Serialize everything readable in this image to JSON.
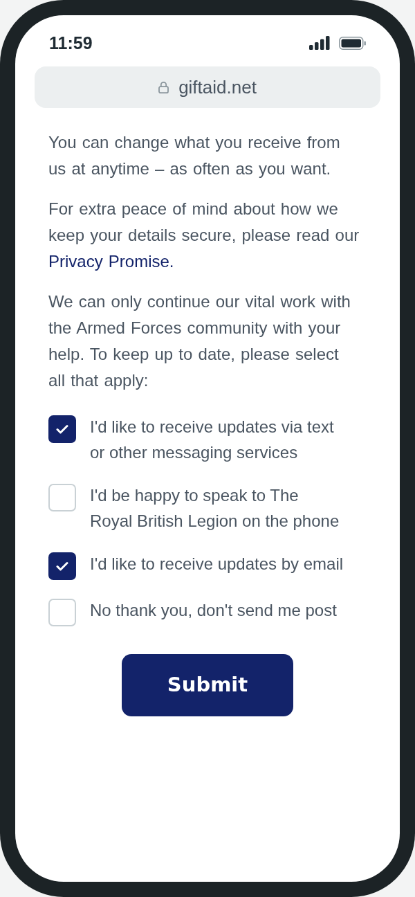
{
  "status_bar": {
    "time": "11:59"
  },
  "address_bar": {
    "url": "giftaid.net"
  },
  "paragraphs": [
    {
      "text": "You can change what you receive from us at anytime – as often as you want."
    },
    {
      "text": "For extra peace of mind about how we keep your details secure, please read our",
      "link": "Privacy Promise."
    },
    {
      "text": "We can only continue our vital work with the Armed Forces community with your help. To keep up to date, please select all that apply:"
    }
  ],
  "options": [
    {
      "label": "I'd like to receive updates via text or other messaging services",
      "checked": true
    },
    {
      "label": "I'd be happy to speak to The Royal British Legion on the phone",
      "checked": false
    },
    {
      "label": "I'd like to receive updates by email",
      "checked": true
    },
    {
      "label": "No thank you, don't send me post",
      "checked": false
    }
  ],
  "submit_button": {
    "label": "Submit"
  }
}
